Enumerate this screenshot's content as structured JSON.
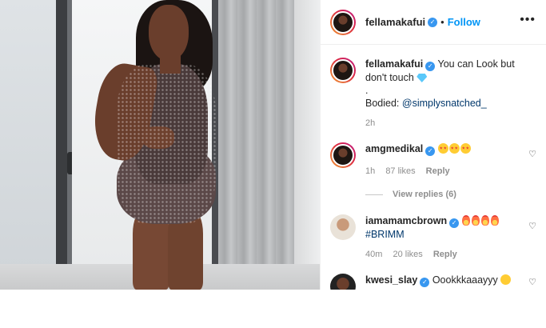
{
  "header": {
    "username": "fellamakafui",
    "separator": "•",
    "follow_label": "Follow",
    "more_icon": "more-horizontal-icon"
  },
  "caption": {
    "username": "fellamakafui",
    "text_line1": "You can Look but don't touch",
    "emoji": "gem-icon",
    "dot_line": ".",
    "bodied_label": "Bodied:",
    "mention": "@simplysnatched_",
    "time": "2h"
  },
  "comments": [
    {
      "username": "amgmedikal",
      "emojis": [
        "star-struck",
        "star-struck",
        "star-struck"
      ],
      "time": "1h",
      "likes": "87 likes",
      "reply_label": "Reply",
      "view_replies": "View replies (6)"
    },
    {
      "username": "iamamamcbrown",
      "emojis": [
        "fire",
        "fire",
        "fire",
        "fire"
      ],
      "hashtag": "#BRIMM",
      "time": "40m",
      "likes": "20 likes",
      "reply_label": "Reply"
    },
    {
      "username": "kwesi_slay",
      "text": "Oookkkaaayyy",
      "emojis": [
        "smile"
      ]
    }
  ],
  "colors": {
    "link_blue": "#0095f6",
    "verified_blue": "#3897f0",
    "secondary_text": "#8e8e8e",
    "mention_color": "#00376b"
  }
}
